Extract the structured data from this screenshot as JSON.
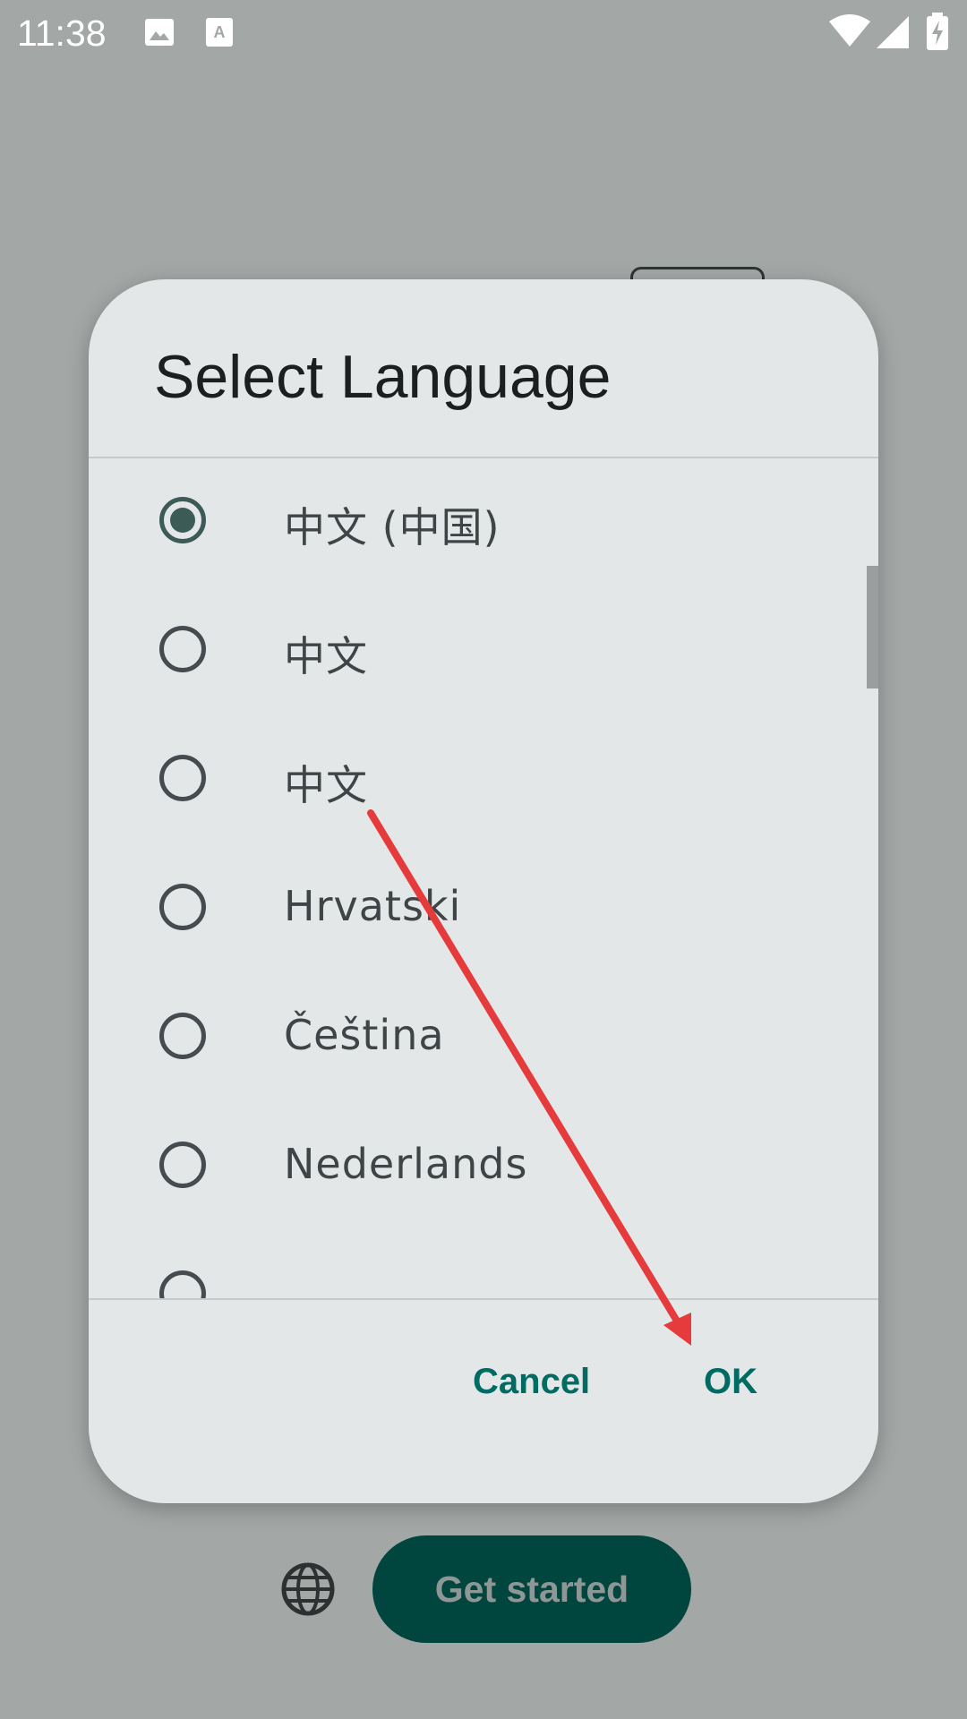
{
  "status_bar": {
    "time": "11:38",
    "icons": [
      "image-icon",
      "font-download-icon",
      "wifi-icon",
      "signal-icon",
      "battery-charging-icon"
    ]
  },
  "dialog": {
    "title": "Select Language",
    "options": [
      {
        "label": "中文 (中国)",
        "selected": true
      },
      {
        "label": "中文",
        "selected": false
      },
      {
        "label": "中文",
        "selected": false
      },
      {
        "label": "Hrvatski",
        "selected": false
      },
      {
        "label": "Čeština",
        "selected": false
      },
      {
        "label": "Nederlands",
        "selected": false
      }
    ],
    "cancel_label": "Cancel",
    "ok_label": "OK"
  },
  "background": {
    "get_started_label": "Get started",
    "language_icon": "globe-icon"
  },
  "annotation": {
    "color": "#e53b3c"
  },
  "colors": {
    "accent": "#006b63",
    "primary_button": "#00453e",
    "dialog_bg": "#e4e7e7",
    "scrim": "#a3a7a6"
  }
}
